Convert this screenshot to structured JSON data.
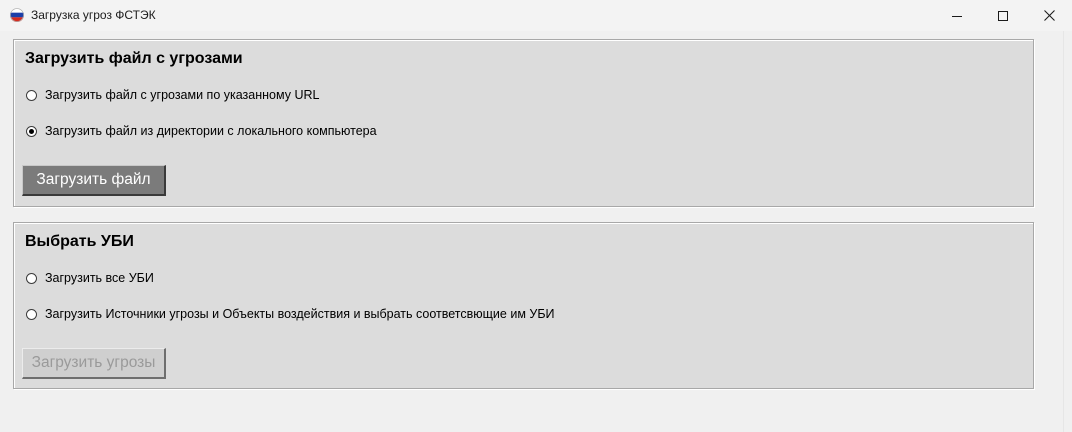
{
  "window": {
    "title": "Загрузка угроз ФСТЭК",
    "icon": "russian-flag-icon",
    "controls": {
      "minimize": "minimize-icon",
      "maximize": "maximize-icon",
      "close": "close-icon"
    }
  },
  "group_upload": {
    "title": "Загрузить файл с угрозами",
    "options": [
      {
        "label": "Загрузить файл с угрозами по указанному URL",
        "checked": false
      },
      {
        "label": "Загрузить файл из директории с локального компьютера",
        "checked": true
      }
    ],
    "button_label": "Загрузить файл",
    "button_enabled": true
  },
  "group_ubi": {
    "title": "Выбрать УБИ",
    "options": [
      {
        "label": "Загрузить все УБИ",
        "checked": false
      },
      {
        "label": "Загрузить Источники угрозы и Объекты воздействия и выбрать соответсвющие им УБИ",
        "checked": false
      }
    ],
    "button_label": "Загрузить угрозы",
    "button_enabled": false
  },
  "colors": {
    "group_background": "#dcdcdc",
    "window_background": "#f0f0f0",
    "button_active": "#7b7b7b",
    "button_disabled": "#cfcfcf"
  }
}
